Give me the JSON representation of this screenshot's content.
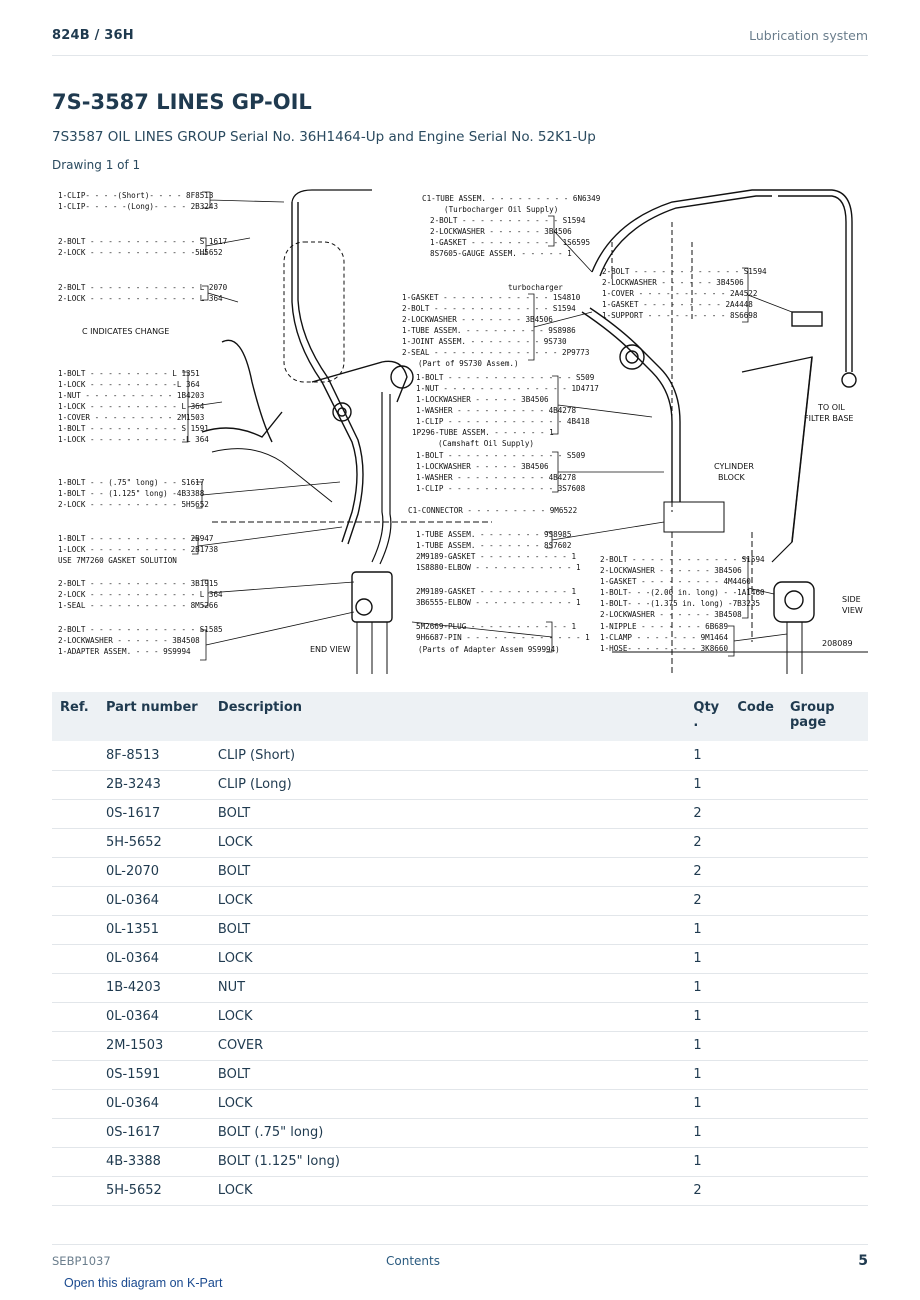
{
  "header": {
    "model": "824B  /  36H",
    "section": "Lubrication system"
  },
  "title": "7S-3587 LINES GP-OIL",
  "subtitle": "7S3587 OIL LINES GROUP Serial No. 36H1464-Up and Engine Serial No. 52K1-Up",
  "drawing_label": "Drawing 1 of 1",
  "diagram": {
    "number": "208089",
    "callouts_left": [
      "1-CLIP- - - -(Short)- - - - 8F8513",
      "1-CLIP- - - - -(Long)- - - - 2B3243",
      "2-BOLT - - - - - - - - - - - - S 1617",
      "2-LOCK - - - - - - - - - - - -5H5652",
      "2-BOLT - - - - - - - - - - - - L 2070",
      "2-LOCK - - - - - - - - - - - - L 364",
      "C INDICATES CHANGE",
      "1-BOLT - - - - - - - - - L 1351",
      "1-LOCK - - - - - - - - - -L 364",
      "1-NUT - - - - - - - - - - 1B4203",
      "1-LOCK - - - - - - - - - - L 364",
      "1-COVER - - - - - - - - - 2M1503",
      "1-BOLT - - - - - - - - - - S 1591",
      "1-LOCK - - - - - - - - - - -L 364",
      "1-BOLT - - (.75\" long) - - S1617",
      "1-BOLT - - (1.125\" long) -4B3388",
      "2-LOCK - - - - - - - - - - 5H5652",
      "1-BOLT - - - - - - - - - - - 2B947",
      "1-LOCK - - - - - - - - - - - 2B1738",
      "USE 7M7260 GASKET SOLUTION",
      "2-BOLT - - - - - - - - - - - 3B1915",
      "2-LOCK - - - - - - - - - - - - L 364",
      "1-SEAL - - - - - - - - - - - 8M5266",
      "2-BOLT - - - - - - - - - - - - S1585",
      "2-LOCKWASHER - - - - - - 3B4508",
      "1-ADAPTER ASSEM. - - - 9S9994"
    ],
    "callouts_center": [
      "C1-TUBE ASSEM. - - - - - - - - - 6N6349",
      "(Turbocharger Oil Supply)",
      "2-BOLT - - - - - - - - - - - S1594",
      "2-LOCKWASHER - - - - - - 3B4506",
      "1-GASKET - - - - - - - - - - 1S6595",
      "8S7605-GAUGE ASSEM. - - - - - 1",
      "turbocharger",
      "1-GASKET - - - - - - - - - - - - 1S4810",
      "2-BOLT - - - - - - - - - - - - - S1594",
      "2-LOCKWASHER - - - - - - - 3B4506",
      "1-TUBE ASSEM. - - - - - - - - - 9S8986",
      "1-JOINT ASSEM. - - - - - - - - 9S730",
      "2-SEAL - - - - - - - - - - - - - - 2P9773",
      "(Part of 9S730 Assem.)",
      "1-BOLT - - - - - - - - - - - - - - S509",
      "1-NUT - - - - - - - - - - - - - - 1D4717",
      "1-LOCKWASHER - - - - - 3B4506",
      "1-WASHER - - - - - - - - - - 4B4278",
      "1-CLIP - - - - - - - - - - - - - 4B418",
      "1P296-TUBE ASSEM. - - - - - - 1",
      "(Camshaft Oil Supply)",
      "1-BOLT - - - - - - - - - - - - - S509",
      "1-LOCKWASHER - - - - - 3B4506",
      "1-WASHER - - - - - - - - - - 4B4278",
      "1-CLIP - - - - - - - - - - - - 3S7608",
      "C1-CONNECTOR - - - - - - - - - 9M6522",
      "1-TUBE ASSEM. - - - - - - - 9S8985",
      "1-TUBE ASSEM. - - - - - - - 8S7602",
      "2M9189-GASKET - - - - - - - - - - 1",
      "1S8880-ELBOW - - - - - - - - - - - 1",
      "2M9189-GASKET - - - - - - - - - - 1",
      "3B6555-ELBOW - - - - - - - - - - - 1",
      "5M2669-PLUG - - - - - - - - - - - 1",
      "9H6687-PIN - - - - - - - - - - - - - 1",
      "(Parts of Adapter Assem 9S9994)"
    ],
    "callouts_right": [
      "2-BOLT - - - - - - - - - - - - S1594",
      "2-LOCKWASHER - - - - - - 3B4506",
      "1-COVER - - - - - - - - - - 2A4522",
      "1-GASKET - - - - - - - - - 2A4448",
      "1-SUPPORT - - - - - - - - - 8S6698",
      "TO OIL",
      "FILTER BASE",
      "CYLINDER",
      "BLOCK",
      "2-BOLT - - - - - - - - - - - - S1594",
      "2-LOCKWASHER - - - - - - 3B4506",
      "1-GASKET - - - - - - - - - 4M4460",
      "1-BOLT- - -(2.00 in. long) - -1A1460",
      "1-BOLT- - -(1.375 in. long) -7B3235",
      "2-LOCKWASHER - - - - - - 3B4508",
      "1-NIPPLE - - - - - - - 6B689",
      "1-CLAMP - - - - - - - 9M1464",
      "1-HOSE- - - - - - - - 3K8660",
      "SIDE",
      "VIEW",
      "END VIEW"
    ]
  },
  "table": {
    "headers": {
      "ref": "Ref.",
      "part_number": "Part number",
      "description": "Description",
      "qty": "Qty\n.",
      "code": "Code",
      "group_page": "Group page"
    },
    "rows": [
      {
        "ref": "",
        "part_number": "8F-8513",
        "description": "CLIP (Short)",
        "qty": "1",
        "code": "",
        "group_page": ""
      },
      {
        "ref": "",
        "part_number": "2B-3243",
        "description": "CLIP (Long)",
        "qty": "1",
        "code": "",
        "group_page": ""
      },
      {
        "ref": "",
        "part_number": "0S-1617",
        "description": "BOLT",
        "qty": "2",
        "code": "",
        "group_page": ""
      },
      {
        "ref": "",
        "part_number": "5H-5652",
        "description": "LOCK",
        "qty": "2",
        "code": "",
        "group_page": ""
      },
      {
        "ref": "",
        "part_number": "0L-2070",
        "description": "BOLT",
        "qty": "2",
        "code": "",
        "group_page": ""
      },
      {
        "ref": "",
        "part_number": "0L-0364",
        "description": "LOCK",
        "qty": "2",
        "code": "",
        "group_page": ""
      },
      {
        "ref": "",
        "part_number": "0L-1351",
        "description": "BOLT",
        "qty": "1",
        "code": "",
        "group_page": ""
      },
      {
        "ref": "",
        "part_number": "0L-0364",
        "description": "LOCK",
        "qty": "1",
        "code": "",
        "group_page": ""
      },
      {
        "ref": "",
        "part_number": "1B-4203",
        "description": "NUT",
        "qty": "1",
        "code": "",
        "group_page": ""
      },
      {
        "ref": "",
        "part_number": "0L-0364",
        "description": "LOCK",
        "qty": "1",
        "code": "",
        "group_page": ""
      },
      {
        "ref": "",
        "part_number": "2M-1503",
        "description": "COVER",
        "qty": "1",
        "code": "",
        "group_page": ""
      },
      {
        "ref": "",
        "part_number": "0S-1591",
        "description": "BOLT",
        "qty": "1",
        "code": "",
        "group_page": ""
      },
      {
        "ref": "",
        "part_number": "0L-0364",
        "description": "LOCK",
        "qty": "1",
        "code": "",
        "group_page": ""
      },
      {
        "ref": "",
        "part_number": "0S-1617",
        "description": "BOLT (.75\" long)",
        "qty": "1",
        "code": "",
        "group_page": ""
      },
      {
        "ref": "",
        "part_number": "4B-3388",
        "description": "BOLT (1.125\" long)",
        "qty": "1",
        "code": "",
        "group_page": ""
      },
      {
        "ref": "",
        "part_number": "5H-5652",
        "description": "LOCK",
        "qty": "2",
        "code": "",
        "group_page": ""
      }
    ]
  },
  "footer": {
    "doc_id": "SEBP1037",
    "contents_link": "Contents",
    "page_number": "5"
  },
  "kpart_link": "Open this diagram on K-Part"
}
